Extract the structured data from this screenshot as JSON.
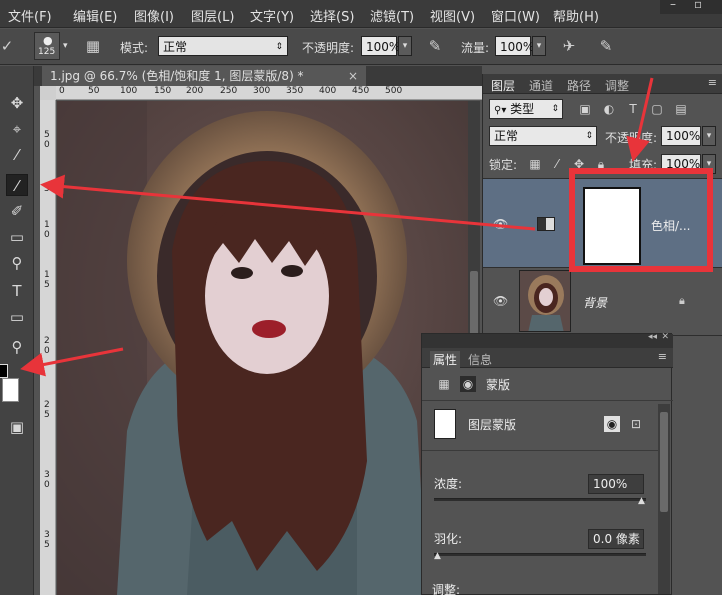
{
  "menu": [
    "文件(F)",
    "编辑(E)",
    "图像(I)",
    "图层(L)",
    "文字(Y)",
    "选择(S)",
    "滤镜(T)",
    "视图(V)",
    "窗口(W)",
    "帮助(H)"
  ],
  "options": {
    "brush_size": "125",
    "mode_label": "模式:",
    "mode_value": "正常",
    "opacity_label": "不透明度:",
    "opacity_value": "100%",
    "flow_label": "流量:",
    "flow_value": "100%"
  },
  "document": {
    "tab_title": "1.jpg @ 66.7% (色相/饱和度 1, 图层蒙版/8) *",
    "close": "×",
    "ruler_h": [
      "0",
      "50",
      "100",
      "150",
      "200",
      "250",
      "300",
      "350",
      "400",
      "450",
      "500"
    ],
    "ruler_v": [
      "5",
      "0",
      "5",
      "1",
      "0",
      "1",
      "5",
      "2",
      "0",
      "2",
      "5",
      "3",
      "0",
      "3",
      "5"
    ]
  },
  "layers_panel": {
    "tabs": [
      "图层",
      "通道",
      "路径",
      "调整"
    ],
    "filter_label": "类型",
    "blend_mode": "正常",
    "opacity_label": "不透明度:",
    "opacity_value": "100%",
    "lock_label": "锁定:",
    "fill_label": "填充:",
    "fill_value": "100%",
    "layers": [
      {
        "name": "色相/...",
        "type": "adjustment"
      },
      {
        "name": "背景",
        "type": "background"
      }
    ]
  },
  "properties_panel": {
    "tabs": [
      "属性",
      "信息"
    ],
    "section": "蒙版",
    "mask_name": "图层蒙版",
    "density_label": "浓度:",
    "density_value": "100%",
    "density": 1.0,
    "feather_label": "羽化:",
    "feather_value": "0.0 像素",
    "feather": 0.0,
    "adjust_label": "调整:"
  },
  "colors": {
    "annotation": "#e8343a",
    "layer_selected": "#5e6f84",
    "foreground_swatch": "#000000",
    "background_swatch": "#ffffff"
  }
}
